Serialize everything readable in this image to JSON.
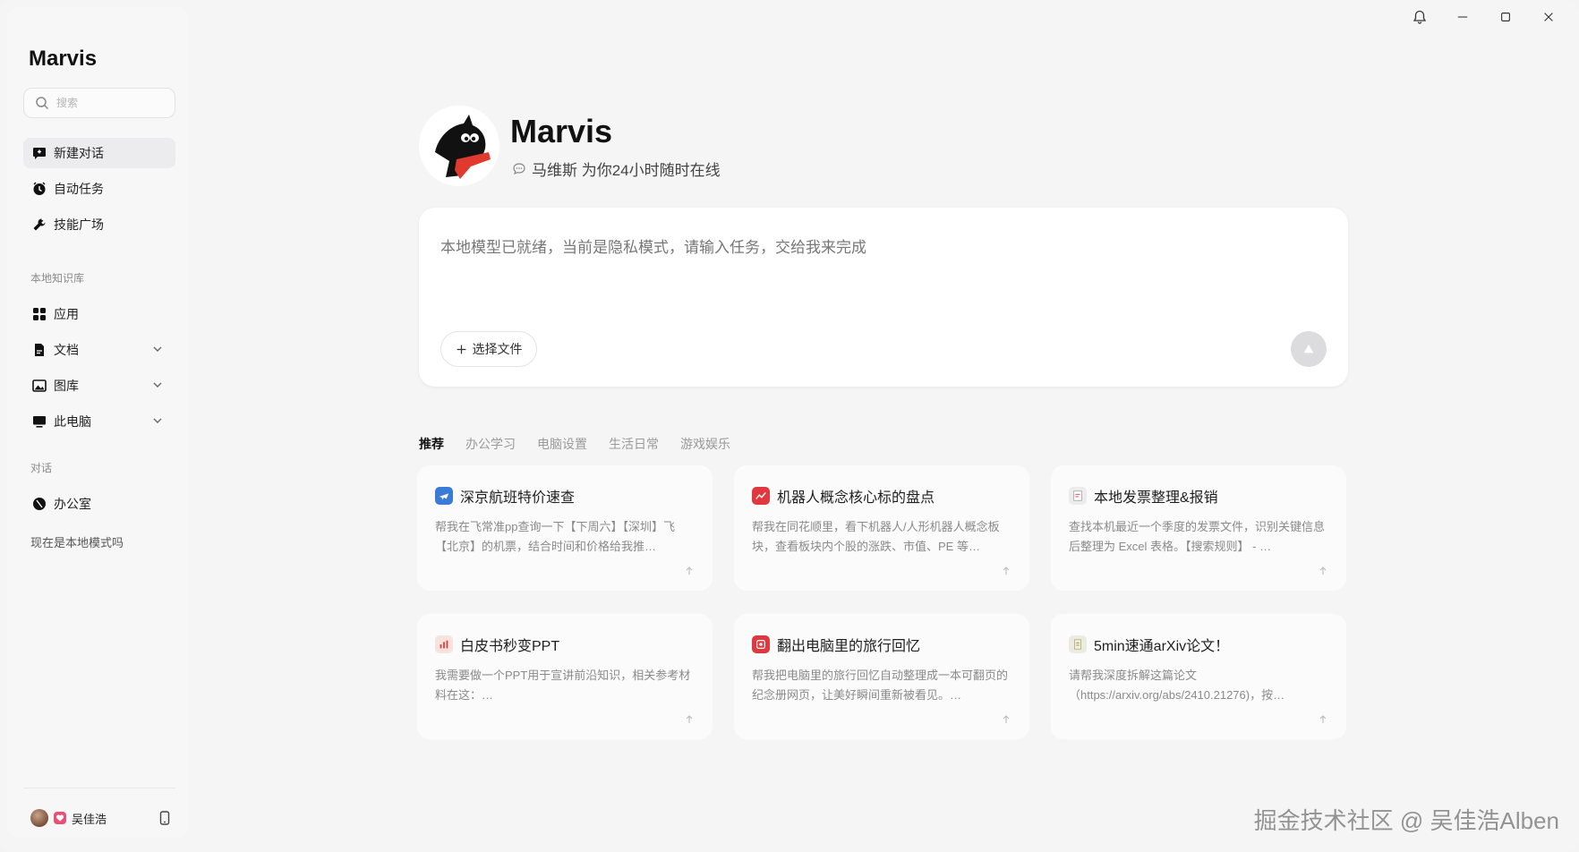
{
  "sidebar": {
    "brand": "Marvis",
    "search_placeholder": "搜索",
    "nav": [
      {
        "label": "新建对话"
      },
      {
        "label": "自动任务"
      },
      {
        "label": "技能广场"
      }
    ],
    "knowledge_label": "本地知识库",
    "knowledge": [
      {
        "label": "应用"
      },
      {
        "label": "文档"
      },
      {
        "label": "图库"
      },
      {
        "label": "此电脑"
      }
    ],
    "chat_label": "对话",
    "chats": [
      {
        "label": "办公室"
      }
    ],
    "recent": "现在是本地模式吗",
    "user_name": "吴佳浩"
  },
  "hero": {
    "title": "Marvis",
    "subtitle": "马维斯 为你24小时随时在线"
  },
  "composer": {
    "placeholder": "本地模型已就绪，当前是隐私模式，请输入任务，交给我来完成",
    "file_button": "选择文件"
  },
  "tabs": [
    {
      "label": "推荐",
      "active": true
    },
    {
      "label": "办公学习"
    },
    {
      "label": "电脑设置"
    },
    {
      "label": "生活日常"
    },
    {
      "label": "游戏娱乐"
    }
  ],
  "cards": [
    {
      "title": "深京航班特价速查",
      "desc": "帮我在飞常准pp查询一下【下周六】【深圳】飞【北京】的机票，结合时间和价格给我推…",
      "icon": "plane-icon",
      "color": "#3a7bd5"
    },
    {
      "title": "机器人概念核心标的盘点",
      "desc": "帮我在同花顺里，看下机器人/人形机器人概念板块，查看板块内个股的涨跌、市值、PE 等…",
      "icon": "stock-chart-icon",
      "color": "#e0383e"
    },
    {
      "title": "本地发票整理&报销",
      "desc": "查找本机最近一个季度的发票文件，识别关键信息后整理为 Excel 表格。【搜索规则】 - …",
      "icon": "invoice-icon",
      "color": "#d9d9d9"
    },
    {
      "title": "白皮书秒变PPT",
      "desc": "我需要做一个PPT用于宣讲前沿知识，相关参考材料在这：…",
      "icon": "ppt-icon",
      "color": "#f0c8b8"
    },
    {
      "title": "翻出电脑里的旅行回忆",
      "desc": "帮我把电脑里的旅行回忆自动整理成一本可翻页的纪念册网页，让美好瞬间重新被看见。…",
      "icon": "album-icon",
      "color": "#e0383e"
    },
    {
      "title": "5min速通arXiv论文！",
      "desc": "请帮我深度拆解这篇论文（https://arxiv.org/abs/2410.21276)，按…",
      "icon": "paper-icon",
      "color": "#d9d9c8"
    }
  ],
  "watermark": "掘金技术社区 @ 吴佳浩Alben"
}
